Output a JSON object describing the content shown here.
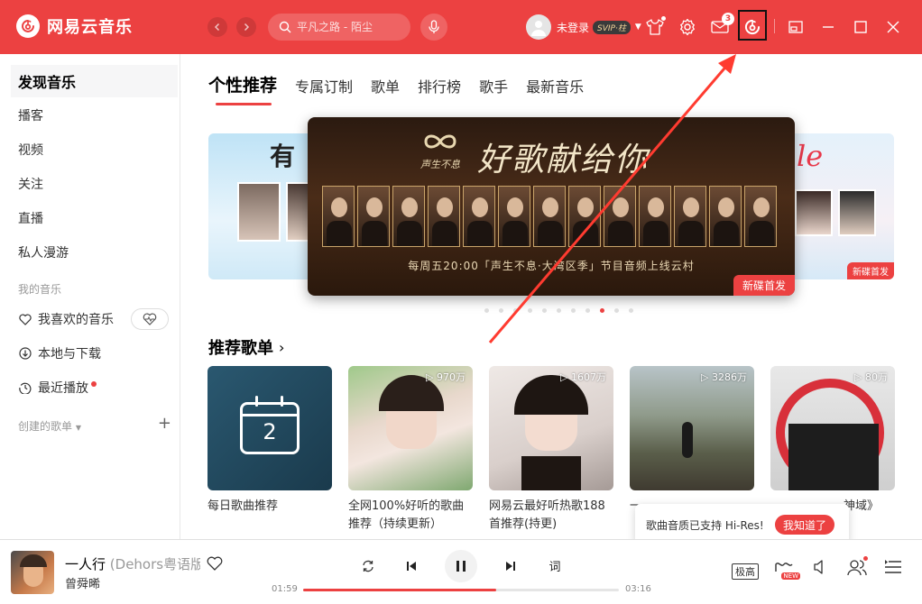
{
  "app": {
    "name": "网易云音乐"
  },
  "colors": {
    "brand": "#ec4141",
    "annotation_arrow": "#ff3b30"
  },
  "header": {
    "search_placeholder": "平凡之路 - 陌尘",
    "login_text": "未登录",
    "vip_badge": "SVIP·柱",
    "mail_count": "3",
    "icons": [
      "back-icon",
      "forward-icon",
      "search-icon",
      "mic-icon",
      "skin-icon",
      "settings-icon",
      "mail-icon",
      "netease-logo-icon",
      "mini-mode-icon",
      "minimize-icon",
      "maximize-icon",
      "close-icon"
    ]
  },
  "sidebar": {
    "items": [
      {
        "label": "发现音乐"
      },
      {
        "label": "播客"
      },
      {
        "label": "视频"
      },
      {
        "label": "关注"
      },
      {
        "label": "直播"
      },
      {
        "label": "私人漫游"
      }
    ],
    "my_music_title": "我的音乐",
    "my_music": [
      {
        "label": "我喜欢的音乐",
        "icon": "heart-icon"
      },
      {
        "label": "本地与下载",
        "icon": "download-icon"
      },
      {
        "label": "最近播放",
        "icon": "history-icon"
      }
    ],
    "created_playlists_title": "创建的歌单"
  },
  "tabs": [
    "个性推荐",
    "专属订制",
    "歌单",
    "排行榜",
    "歌手",
    "最新音乐"
  ],
  "banner": {
    "title": "好歌献给你",
    "brand": "声生不息",
    "caption": "每周五20:00「声生不息·大湾区季」节目音频上线云村",
    "tag": "新碟首发",
    "left_partial_text": "有",
    "right_partial_text": "le",
    "right_tag": "新碟首发",
    "dot_count": 11,
    "active_dot": 8
  },
  "recommend": {
    "title": "推荐歌单",
    "playlists": [
      {
        "name": "每日歌曲推荐",
        "count": "",
        "date": "2"
      },
      {
        "name": "全网100%好听的歌曲推荐（持续更新）",
        "count": "970万"
      },
      {
        "name": "网易云最好听热歌188首推荐(持更)",
        "count": "1607万"
      },
      {
        "name": "一",
        "count": "3286万"
      },
      {
        "name": "神域》",
        "count": "80万"
      }
    ]
  },
  "tooltip": {
    "text": "歌曲音质已支持 Hi-Res!",
    "button": "我知道了"
  },
  "player": {
    "song_title": "一人行",
    "song_subtitle": "(Dehors粤语版)",
    "artist": "曾舜晞",
    "current_time": "01:59",
    "total_time": "03:16",
    "progress": 0.61,
    "lyric_label": "词",
    "quality": "极高",
    "new_badge": "NEW"
  }
}
